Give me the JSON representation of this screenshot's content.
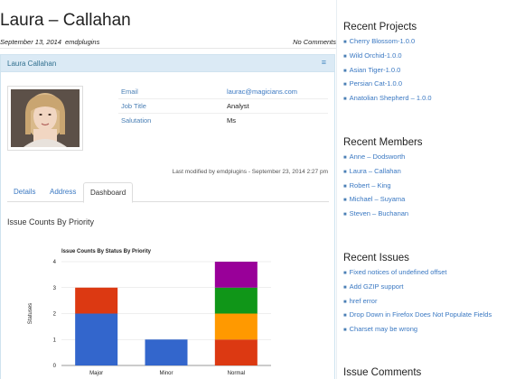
{
  "post": {
    "title": "Laura – Callahan",
    "date": "September 13, 2014",
    "author": "emdplugins",
    "comments": "No Comments"
  },
  "panel": {
    "title": "Laura Callahan",
    "toggle_icon": "hamburger-icon"
  },
  "contact": {
    "fields": [
      {
        "label": "Email",
        "value": "laurac@magicians.com"
      },
      {
        "label": "Job Title",
        "value": "Analyst"
      },
      {
        "label": "Salutation",
        "value": "Ms"
      }
    ]
  },
  "modified": "Last modified by emdplugins - September 23, 2014 2:27 pm",
  "tabs": [
    {
      "label": "Details",
      "active": false
    },
    {
      "label": "Address",
      "active": false
    },
    {
      "label": "Dashboard",
      "active": true
    }
  ],
  "section_title": "Issue Counts By Priority",
  "chart_data": {
    "type": "bar",
    "stacked": true,
    "title": "Issue Counts By Status By Priority",
    "xlabel": "",
    "ylabel": "Statuses",
    "categories": [
      "Major",
      "Minor",
      "Normal"
    ],
    "ylim": [
      0,
      4
    ],
    "yticks": [
      0,
      1,
      2,
      3,
      4
    ],
    "grid": true,
    "series": [
      {
        "color": "#3366cc",
        "values": [
          2,
          1,
          0
        ]
      },
      {
        "color": "#dc3912",
        "values": [
          1,
          0,
          1
        ]
      },
      {
        "color": "#ff9900",
        "values": [
          0,
          0,
          1
        ]
      },
      {
        "color": "#109618",
        "values": [
          0,
          0,
          1
        ]
      },
      {
        "color": "#990099",
        "values": [
          0,
          0,
          1
        ]
      }
    ]
  },
  "sidebar": {
    "recent_projects": {
      "title": "Recent Projects",
      "items": [
        "Cherry Blossom-1.0.0",
        "Wild Orchid-1.0.0",
        "Asian Tiger-1.0.0",
        "Persian Cat-1.0.0",
        "Anatolian Shepherd – 1.0.0"
      ]
    },
    "recent_members": {
      "title": "Recent Members",
      "items": [
        "Anne – Dodsworth",
        "Laura – Callahan",
        "Robert – King",
        "Michael – Suyama",
        "Steven – Buchanan"
      ]
    },
    "recent_issues": {
      "title": "Recent Issues",
      "items": [
        "Fixed notices of undefined offset",
        "Add GZIP support",
        "href error",
        "Drop Down in Firefox Does Not Populate Fields",
        "Charset may be wrong"
      ]
    },
    "issue_comments": {
      "title": "Issue Comments"
    }
  }
}
